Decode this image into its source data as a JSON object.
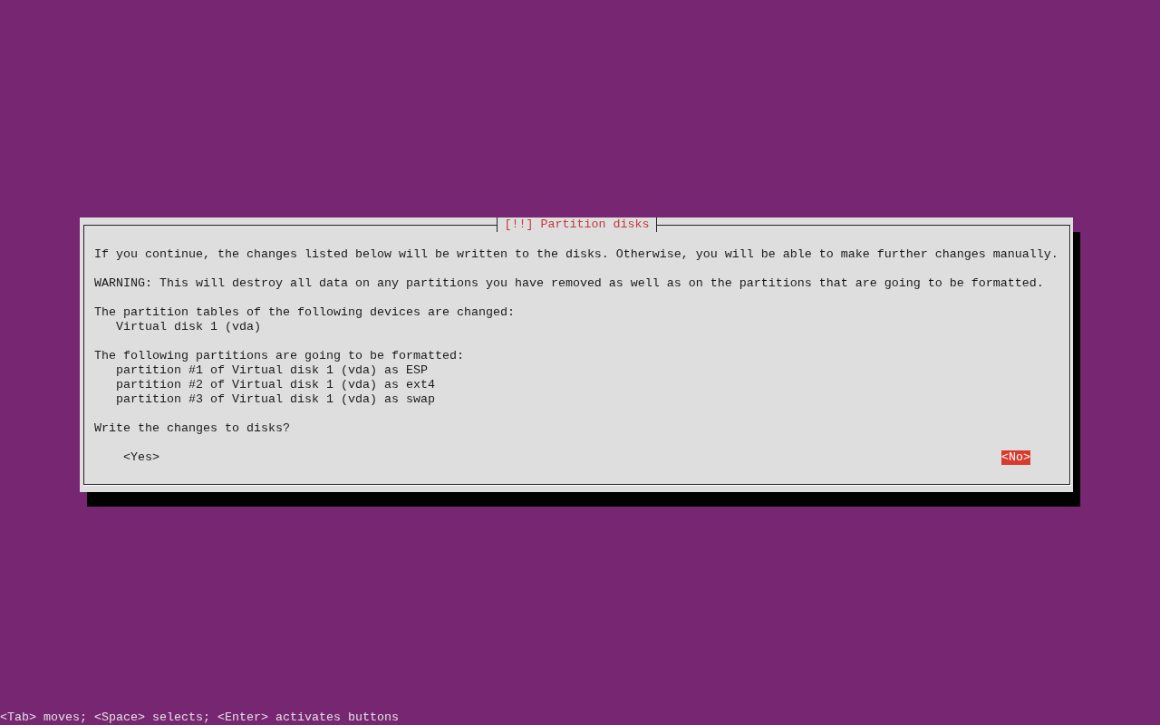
{
  "dialog": {
    "title": "[!!] Partition disks",
    "paragraphs": [
      {
        "text": "If you continue, the changes listed below will be written to the disks. Otherwise, you will be able to make further changes manually."
      },
      {
        "text": "WARNING: This will destroy all data on any partitions you have removed as well as on the partitions that are going to be formatted."
      },
      {
        "text": "The partition tables of the following devices are changed:",
        "items": [
          "Virtual disk 1 (vda)"
        ]
      },
      {
        "text": "The following partitions are going to be formatted:",
        "items": [
          "partition #1 of Virtual disk 1 (vda) as ESP",
          "partition #2 of Virtual disk 1 (vda) as ext4",
          "partition #3 of Virtual disk 1 (vda) as swap"
        ]
      },
      {
        "text": "Write the changes to disks?"
      }
    ],
    "buttons": [
      {
        "label": "<Yes>",
        "selected": false
      },
      {
        "label": "<No>",
        "selected": true
      }
    ]
  },
  "status_bar": "<Tab> moves; <Space> selects; <Enter> activates buttons"
}
